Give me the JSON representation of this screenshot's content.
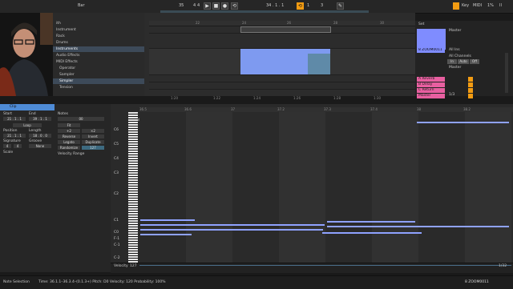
{
  "transport": {
    "tempo": "35",
    "time_sig_num": "4",
    "time_sig_den": "4",
    "position": "34 . 1 . 1",
    "bar_label": "Bar",
    "key": "Key",
    "midi": "MIDI",
    "cpu": "1%",
    "tempo_unit": "II",
    "loop_start": "1",
    "loop_len": "3"
  },
  "browser": {
    "items": [
      {
        "label": "ith"
      },
      {
        "label": "Instrument"
      },
      {
        "label": "Rack"
      },
      {
        "label": "Drums"
      },
      {
        "label": "Instruments"
      },
      {
        "label": "Audio Effects"
      },
      {
        "label": "MIDI Effects"
      },
      {
        "label": "Operator"
      },
      {
        "label": "Sampler"
      },
      {
        "label": "Simpler"
      },
      {
        "label": "Tension"
      }
    ]
  },
  "arrangement": {
    "ruler_marks": [
      "22",
      "24",
      "26",
      "28",
      "30"
    ],
    "time_marks": [
      "1:20",
      "1:22",
      "1:24",
      "1:26",
      "1:28",
      "1:30"
    ]
  },
  "mixer": {
    "set_label": "Set",
    "master_label": "Master",
    "track_name": "8 ZOOM0011",
    "in_label": "All Ins",
    "channels_label": "All Channels",
    "monitor_in": "In",
    "monitor_auto": "Auto",
    "monitor_off": "Off",
    "returns": [
      {
        "name": "A Reverb",
        "color": "#e85fa0"
      },
      {
        "name": "B Delay",
        "color": "#e85fa0"
      },
      {
        "name": "C Return",
        "color": "#e85fa0"
      },
      {
        "name": "Master",
        "color": "#e85fa0"
      }
    ],
    "sends_fraction": "1/3"
  },
  "clip": {
    "title": "Clip",
    "start_label": "Start",
    "end_label": "End",
    "loop_label": "Loop",
    "position_label": "Position",
    "length_label": "Length",
    "signature_label": "Signature",
    "groove_label": "Groove",
    "scale_label": "Scale",
    "groove_value": "None",
    "sig_num": "4",
    "sig_den": "4",
    "notes_title": "Notes",
    "transpose_value": "00",
    "fit_label": "Fit",
    "reverse_label": "Reverse",
    "invert_label": "Invert",
    "legato_label": "Legato",
    "duplicate_label": "Duplicate",
    "randomize_label": "Randomize",
    "randomize_value": "127",
    "velocity_range_label": "Velocity Range",
    "plus_label": "+2",
    "half_label": ":2",
    "double_label": "×2",
    "start_value": "21 . 1 . 1",
    "end_value": "39 . 1 . 1",
    "pos_value": "21 . 1 . 1",
    "len_value": "18 . 0 . 0"
  },
  "pianoroll": {
    "fold_label": "Fold",
    "scale_toggle": "Scale",
    "ruler_marks": [
      "36.5",
      "36.6",
      "37",
      "37.2",
      "37.3",
      "37.4",
      "38",
      "38.2"
    ],
    "note_labels": [
      "C6",
      "C5",
      "C4",
      "C3",
      "C2",
      "C1",
      "C0",
      "F-1",
      "C-1",
      "C-2"
    ],
    "velocity_label": "Velocity",
    "velocity_value": "127",
    "page_counter": "1/32"
  },
  "status": {
    "selection": "Note Selection",
    "details": "Time: 36.1.1–36.3.4–(0.1.3+)  Pitch: D0  Velocity: 120  Probability: 100%",
    "track": "8 ZOOM0011"
  },
  "colors": {
    "accent": "#f39c12",
    "clip_blue": "#6f8ee8",
    "clip_head": "#4e8bd6",
    "track_color": "#7f8cff",
    "return_color": "#e85fa0"
  }
}
